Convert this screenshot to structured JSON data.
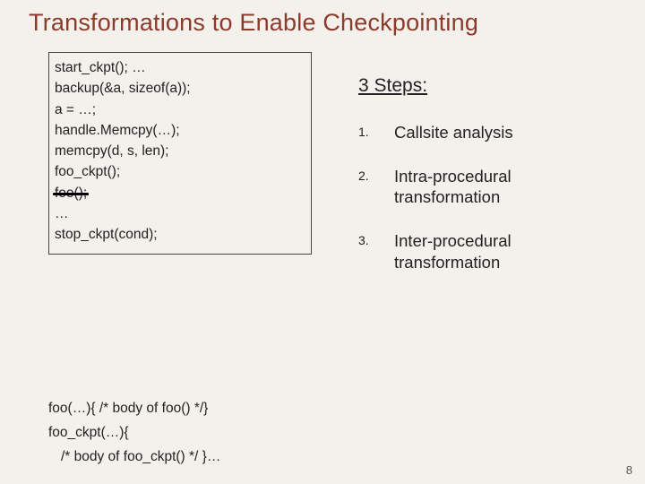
{
  "title": "Transformations to Enable Checkpointing",
  "code": {
    "l1": "start_ckpt(); …",
    "l2": "backup(&a, sizeof(a));",
    "l3": "a = …;",
    "l4": "handle.Memcpy(…);",
    "l5": "memcpy(d, s, len);",
    "l6": "foo_ckpt();",
    "l7": "foo();",
    "l8": "…",
    "l9": "stop_ckpt(cond);"
  },
  "lower": {
    "l1": "foo(…){ /* body of foo() */}",
    "l2": "foo_ckpt(…){",
    "l3": "/* body of foo_ckpt() */   }…"
  },
  "right": {
    "heading": "3 Steps:",
    "items": {
      "i1": "Callsite analysis",
      "i2": "Intra-procedural transformation",
      "i3": "Inter-procedural transformation"
    }
  },
  "page": "8"
}
